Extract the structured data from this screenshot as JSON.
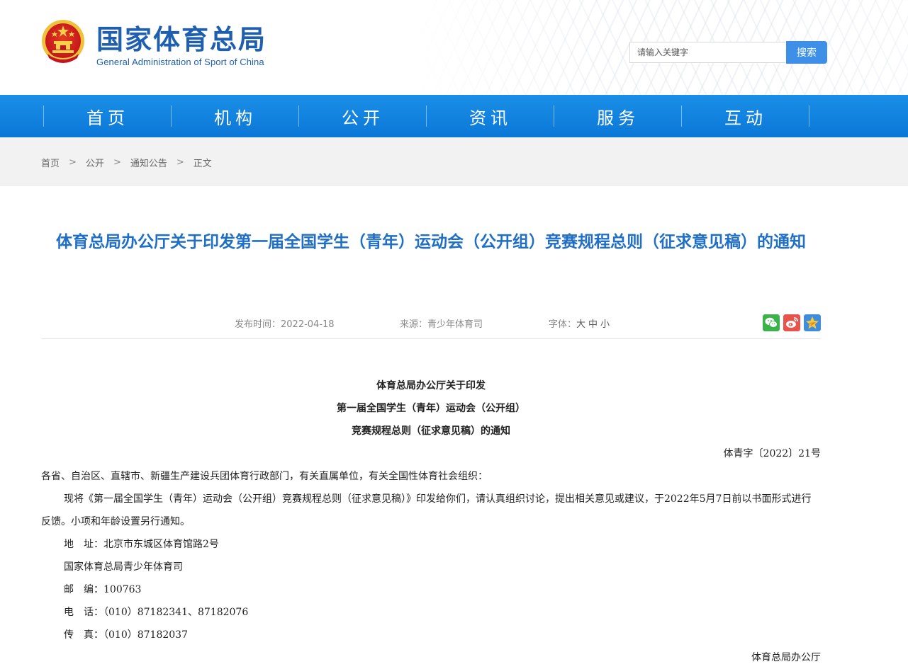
{
  "header": {
    "title_cn": "国家体育总局",
    "title_en": "General Administration of Sport of China",
    "search_placeholder": "请输入关键字",
    "search_button": "搜索"
  },
  "nav": {
    "items": [
      "首页",
      "机构",
      "公开",
      "资讯",
      "服务",
      "互动"
    ]
  },
  "breadcrumb": {
    "items": [
      "首页",
      "公开",
      "通知公告",
      "正文"
    ],
    "separator": ">"
  },
  "article": {
    "title": "体育总局办公厅关于印发第一届全国学生（青年）运动会（公开组）竞赛规程总则（征求意见稿）的通知",
    "meta": {
      "publish_time": "发布时间：2022-04-18",
      "source": "来源：青少年体育司",
      "font_label": "字体：",
      "font_large": "大",
      "font_medium": "中",
      "font_small": "小"
    },
    "share": {
      "icons": [
        "wechat-icon",
        "weibo-icon",
        "qzone-icon"
      ],
      "colors": {
        "wechat": "#3bb34a",
        "weibo": "#e8544a",
        "qzone": "#3e8ddc"
      }
    },
    "doc_heading": [
      "体育总局办公厅关于印发",
      "第一届全国学生（青年）运动会（公开组）",
      "竞赛规程总则（征求意见稿）的通知"
    ],
    "doc_number": "体青字〔2022〕21号",
    "recipients": "各省、自治区、直辖市、新疆生产建设兵团体育行政部门，有关直属单位，有关全国性体育社会组织：",
    "paragraph": "现将《第一届全国学生（青年）运动会（公开组）竞赛规程总则（征求意见稿）》印发给你们，请认真组织讨论，提出相关意见或建议，于2022年5月7日前以书面形式进行反馈。小项和年龄设置另行通知。",
    "contact": {
      "address": "地　址：北京市东城区体育馆路2号",
      "dept": "国家体育总局青少年体育司",
      "zip": "邮　编：100763",
      "phone": "电　话：（010）87182341、87182076",
      "fax": "传　真：（010）87182037"
    },
    "signature": "体育总局办公厅"
  },
  "colors": {
    "brand_blue": "#1f5fb0",
    "nav_blue": "#0b7fde",
    "title_blue": "#1f6fc6"
  }
}
